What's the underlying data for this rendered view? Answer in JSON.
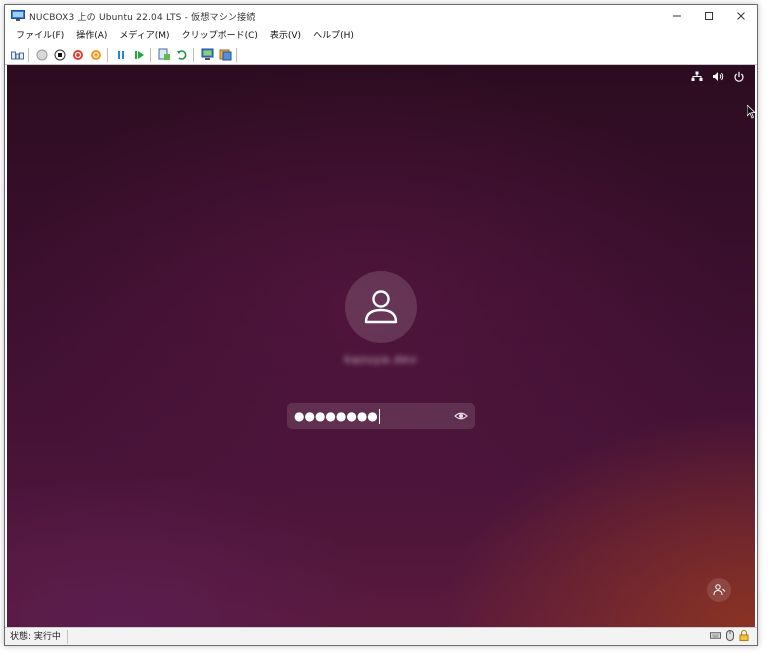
{
  "window": {
    "title": "NUCBOX3 上の Ubuntu 22.04 LTS - 仮想マシン接続",
    "controls": [
      "minimize-icon",
      "maximize-icon",
      "close-icon"
    ]
  },
  "menu": {
    "items": [
      "ファイル(F)",
      "操作(A)",
      "メディア(M)",
      "クリップボード(C)",
      "表示(V)",
      "ヘルプ(H)"
    ]
  },
  "toolbar": {
    "buttons": [
      {
        "icon": "ctrl-alt-del-icon"
      },
      {
        "icon": "start-icon"
      },
      {
        "icon": "turn-off-icon"
      },
      {
        "icon": "shutdown-icon"
      },
      {
        "icon": "save-icon"
      },
      {
        "icon": "pause-icon"
      },
      {
        "icon": "resume-icon"
      },
      {
        "icon": "checkpoint-icon"
      },
      {
        "icon": "revert-icon"
      },
      {
        "icon": "enhanced-session-icon"
      },
      {
        "icon": "share-icon"
      }
    ]
  },
  "vm_screen": {
    "top_icons": [
      "network-icon",
      "volume-icon",
      "power-icon"
    ],
    "username": "kazuya.dev",
    "password_mask": "●●●●●●●●",
    "password_length": 8,
    "accent": "#5a1a3d"
  },
  "status": {
    "text": "状態: 実行中",
    "icons": [
      "keyboard-icon",
      "mouse-icon",
      "lock-icon"
    ]
  }
}
